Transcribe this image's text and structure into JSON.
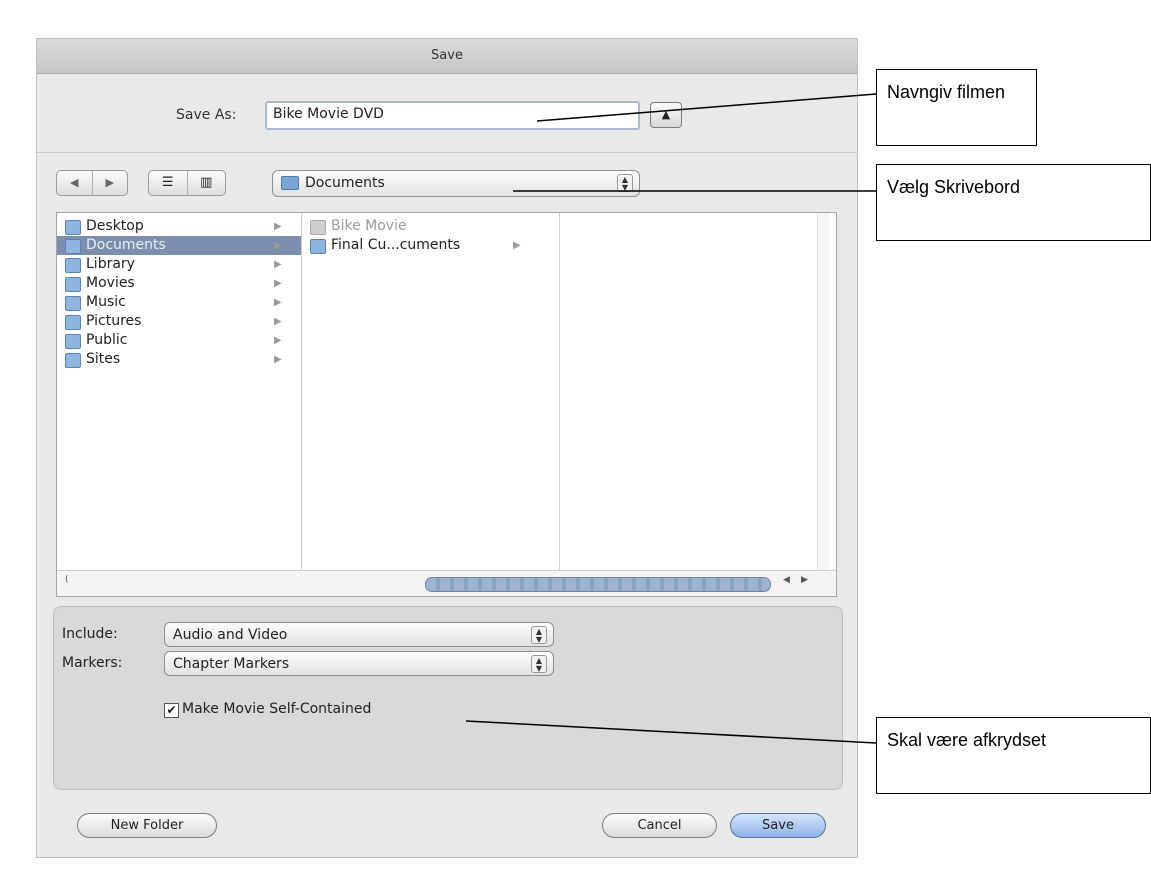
{
  "dialog": {
    "title": "Save",
    "save_as_label": "Save As:",
    "filename_value": "Bike Movie DVD",
    "location_value": "Documents",
    "sidebar_items": [
      {
        "label": "Desktop",
        "selected": false
      },
      {
        "label": "Documents",
        "selected": true
      },
      {
        "label": "Library",
        "selected": false
      },
      {
        "label": "Movies",
        "selected": false
      },
      {
        "label": "Music",
        "selected": false
      },
      {
        "label": "Pictures",
        "selected": false
      },
      {
        "label": "Public",
        "selected": false
      },
      {
        "label": "Sites",
        "selected": false
      }
    ],
    "column2_items": [
      {
        "label": "Bike Movie",
        "dimmed": true
      },
      {
        "label": "Final Cu...cuments",
        "dimmed": false
      }
    ],
    "include_label": "Include:",
    "include_value": "Audio and Video",
    "markers_label": "Markers:",
    "markers_value": "Chapter Markers",
    "self_contained_label": "Make Movie Self-Contained",
    "self_contained_checked": true,
    "new_folder_label": "New Folder",
    "cancel_label": "Cancel",
    "save_label": "Save"
  },
  "callouts": {
    "name_movie": "Navngiv filmen",
    "choose_desktop": "Vælg Skrivebord",
    "must_be_checked": "Skal være afkrydset"
  }
}
